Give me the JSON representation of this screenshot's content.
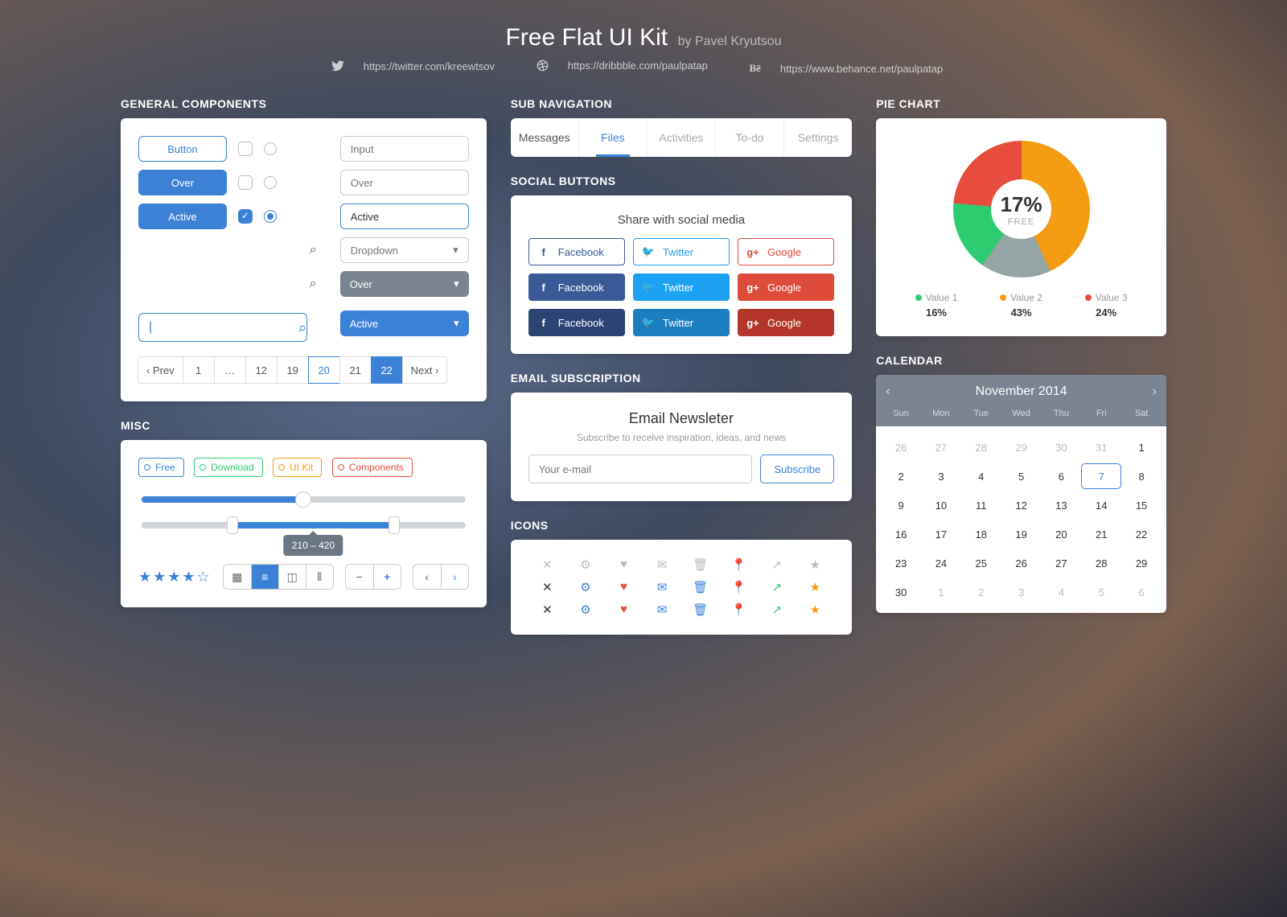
{
  "header": {
    "title": "Free Flat UI Kit",
    "author": "by Pavel Kryutsou"
  },
  "links": {
    "twitter": "https://twitter.com/kreewtsov",
    "dribbble": "https://dribbble.com/paulpatap",
    "behance": "https://www.behance.net/paulpatap"
  },
  "general": {
    "title": "GENERAL COMPONENTS",
    "buttons": {
      "normal": "Button",
      "over": "Over",
      "active": "Active"
    },
    "inputs": {
      "normal": "Input",
      "over": "Over",
      "active": "Active"
    },
    "dropdowns": {
      "normal": "Dropdown",
      "over": "Over",
      "active": "Active"
    },
    "pager": {
      "prev": "‹ Prev",
      "p0": "1",
      "p1": "…",
      "p2": "12",
      "p3": "19",
      "p4": "20",
      "p5": "21",
      "p6": "22",
      "next": "Next ›"
    }
  },
  "misc": {
    "title": "MISC",
    "tags": {
      "free": "Free",
      "download": "Download",
      "uikit": "UI Kit",
      "components": "Components"
    },
    "range_tip": "210 – 420",
    "stars": "★★★★☆"
  },
  "subnav": {
    "title": "SUB NAVIGATION",
    "t0": "Messages",
    "t1": "Files",
    "t2": "Activities",
    "t3": "To-do",
    "t4": "Settings"
  },
  "social": {
    "title": "SOCIAL BUTTONS",
    "heading": "Share with social media",
    "fb": "Facebook",
    "tw": "Twitter",
    "gg": "Google"
  },
  "email": {
    "title": "EMAIL SUBSCRIPTION",
    "heading": "Email Newsleter",
    "sub": "Subscribe to receive inspiration, ideas, and news",
    "placeholder": "Your e-mail",
    "btn": "Subscribe"
  },
  "icons": {
    "title": "ICONS"
  },
  "pie": {
    "title": "PIE CHART",
    "center_value": "17%",
    "center_label": "FREE",
    "l1": "Value 1",
    "l2": "Value 2",
    "l3": "Value 3",
    "p1": "16%",
    "p2": "43%",
    "p3": "24%"
  },
  "calendar": {
    "title": "CALENDAR",
    "month": "November 2014",
    "dow": {
      "0": "Sun",
      "1": "Mon",
      "2": "Tue",
      "3": "Wed",
      "4": "Thu",
      "5": "Fri",
      "6": "Sat"
    },
    "cells": {
      "0": "26",
      "1": "27",
      "2": "28",
      "3": "29",
      "4": "30",
      "5": "31",
      "6": "1",
      "7": "2",
      "8": "3",
      "9": "4",
      "10": "5",
      "11": "6",
      "12": "7",
      "13": "8",
      "14": "9",
      "15": "10",
      "16": "11",
      "17": "12",
      "18": "13",
      "19": "14",
      "20": "15",
      "21": "16",
      "22": "17",
      "23": "18",
      "24": "19",
      "25": "20",
      "26": "21",
      "27": "22",
      "28": "23",
      "29": "24",
      "30": "25",
      "31": "26",
      "32": "27",
      "33": "28",
      "34": "29",
      "35": "30",
      "36": "1",
      "37": "2",
      "38": "3",
      "39": "4",
      "40": "5",
      "41": "6"
    }
  },
  "chart_data": {
    "type": "pie",
    "title": "Pie Chart",
    "center": {
      "value": 17,
      "label": "FREE"
    },
    "series": [
      {
        "name": "Value 1",
        "value": 16,
        "color": "#2ecc71"
      },
      {
        "name": "Value 2",
        "value": 43,
        "color": "#f39c12"
      },
      {
        "name": "Value 3",
        "value": 24,
        "color": "#e74c3c"
      },
      {
        "name": "Free",
        "value": 17,
        "color": "#95a5a6"
      }
    ]
  }
}
